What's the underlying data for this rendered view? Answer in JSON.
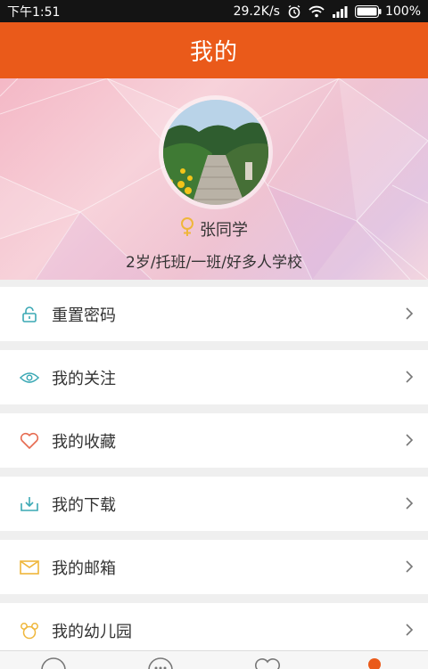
{
  "status_bar": {
    "time": "下午1:51",
    "network_speed": "29.2K/s",
    "battery": "100%"
  },
  "header": {
    "title": "我的"
  },
  "profile": {
    "name": "张同学",
    "details": "2岁/托班/一班/好多人学校"
  },
  "menu": [
    {
      "label": "重置密码",
      "icon": "lock-icon"
    },
    {
      "label": "我的关注",
      "icon": "eye-icon"
    },
    {
      "label": "我的收藏",
      "icon": "heart-icon"
    },
    {
      "label": "我的下载",
      "icon": "download-icon"
    },
    {
      "label": "我的邮箱",
      "icon": "mail-icon"
    },
    {
      "label": "我的幼儿园",
      "icon": "kindergarten-icon"
    }
  ],
  "colors": {
    "accent": "#ea5a1a",
    "icon_teal": "#3aa8b4",
    "icon_coral": "#e66b50",
    "icon_yellow": "#efb63a"
  }
}
